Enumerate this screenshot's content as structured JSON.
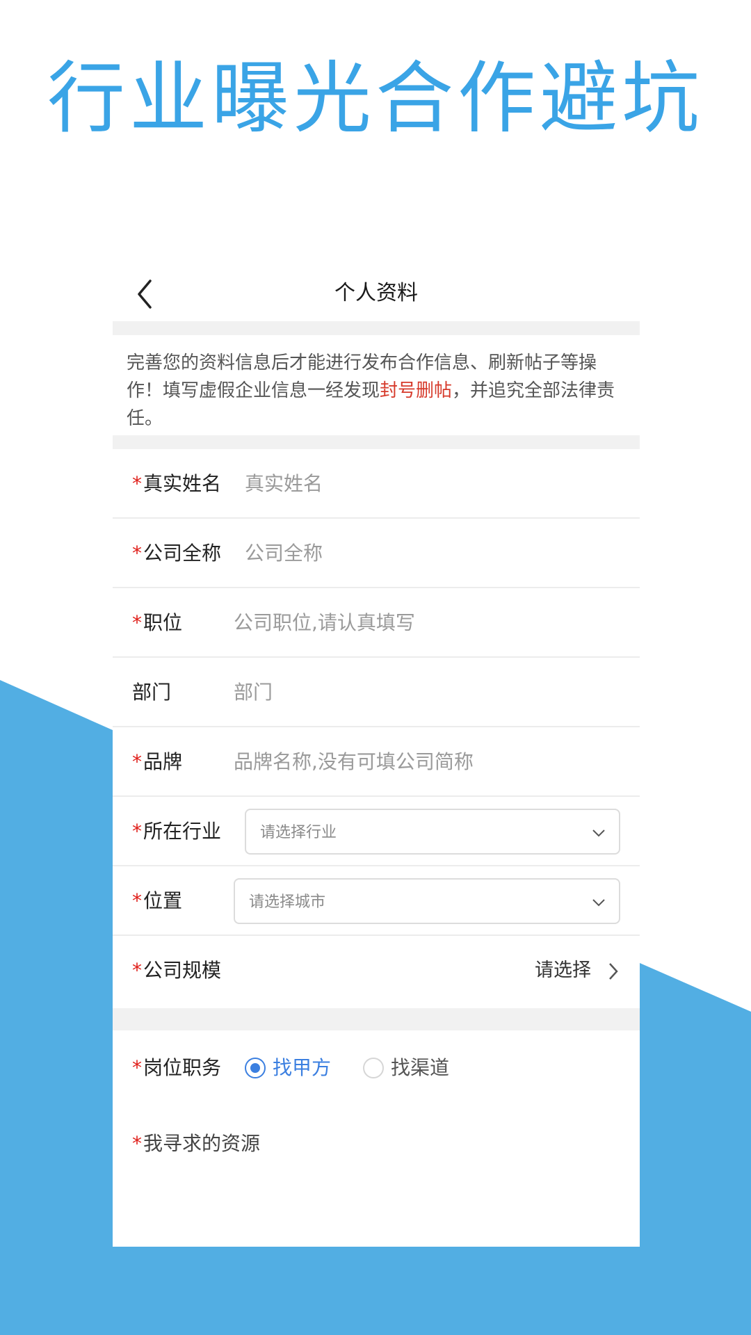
{
  "promo": {
    "headline": "行业曝光合作避坑"
  },
  "navbar": {
    "title": "个人资料"
  },
  "notice": {
    "text_before": "完善您的资料信息后才能进行发布合作信息、刷新帖子等操作！填写虚假企业信息一经发现",
    "highlight": "封号删帖",
    "text_after": "，并追究全部法律责任。"
  },
  "form": {
    "required_mark": "*",
    "name": {
      "label": "真实姓名",
      "placeholder": "真实姓名"
    },
    "company": {
      "label": "公司全称",
      "placeholder": "公司全称"
    },
    "position": {
      "label": "职位",
      "placeholder": "公司职位,请认真填写"
    },
    "department": {
      "label": "部门",
      "placeholder": "部门"
    },
    "brand": {
      "label": "品牌",
      "placeholder": "品牌名称,没有可填公司简称"
    },
    "industry": {
      "label": "所在行业",
      "select_placeholder": "请选择行业"
    },
    "location": {
      "label": "位置",
      "select_placeholder": "请选择城市"
    },
    "scale": {
      "label": "公司规模",
      "value": "请选择"
    },
    "role": {
      "label": "岗位职务",
      "options": [
        {
          "label": "找甲方",
          "selected": true
        },
        {
          "label": "找渠道",
          "selected": false
        }
      ]
    },
    "resource": {
      "label": "我寻求的资源"
    }
  },
  "colors": {
    "accent": "#3b7fe0",
    "brand_blue": "#52aee3",
    "warn": "#d63a2b",
    "required": "#e0201b"
  }
}
